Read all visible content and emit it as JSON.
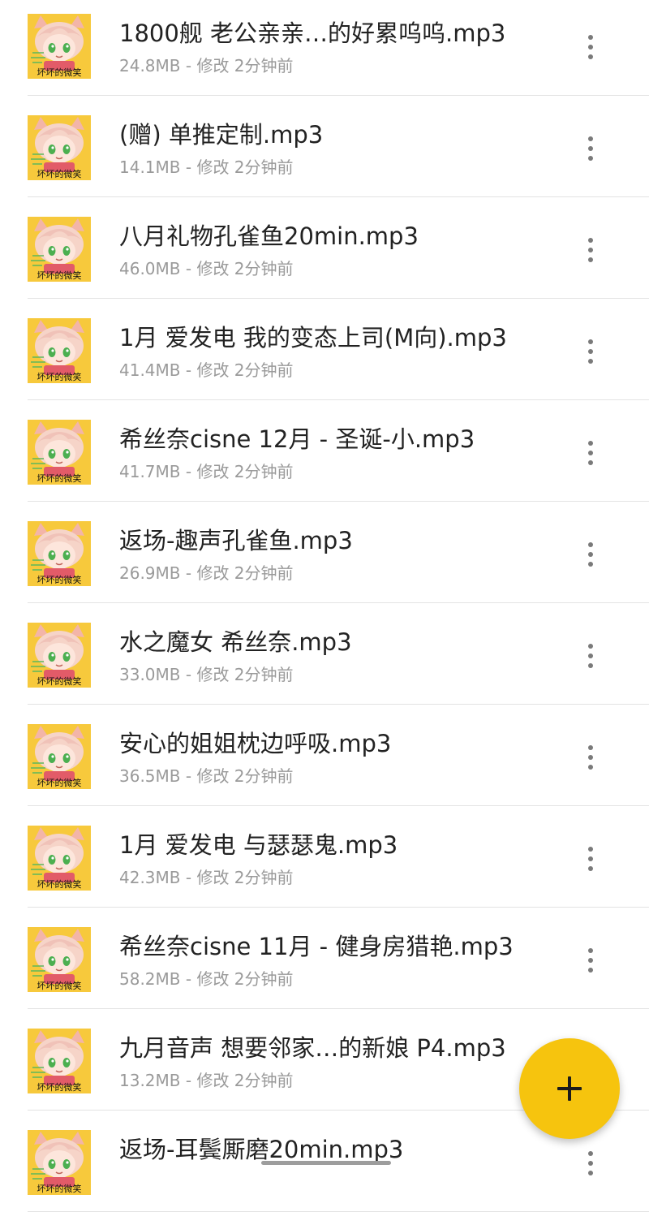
{
  "files": [
    {
      "name": "1800舰 老公亲亲…的好累呜呜.mp3",
      "meta": "24.8MB - 修改 2分钟前"
    },
    {
      "name": "(赠) 单推定制.mp3",
      "meta": "14.1MB - 修改 2分钟前"
    },
    {
      "name": "八月礼物孔雀鱼20min.mp3",
      "meta": "46.0MB - 修改 2分钟前"
    },
    {
      "name": "1月 爱发电 我的变态上司(M向).mp3",
      "meta": "41.4MB - 修改 2分钟前"
    },
    {
      "name": "希丝奈cisne 12月 - 圣诞-小.mp3",
      "meta": "41.7MB - 修改 2分钟前"
    },
    {
      "name": "返场-趣声孔雀鱼.mp3",
      "meta": "26.9MB - 修改 2分钟前"
    },
    {
      "name": "水之魔女 希丝奈.mp3",
      "meta": "33.0MB - 修改 2分钟前"
    },
    {
      "name": "安心的姐姐枕边呼吸.mp3",
      "meta": "36.5MB - 修改 2分钟前"
    },
    {
      "name": "1月 爱发电 与瑟瑟鬼.mp3",
      "meta": "42.3MB - 修改 2分钟前"
    },
    {
      "name": "希丝奈cisne 11月 - 健身房猎艳.mp3",
      "meta": "58.2MB - 修改 2分钟前"
    },
    {
      "name": "九月音声 想要邻家…的新娘 P4.mp3",
      "meta": "13.2MB - 修改 2分钟前"
    },
    {
      "name": "返场-耳鬓厮磨20min.mp3",
      "meta": ""
    }
  ],
  "thumbnail": {
    "caption": "坏坏的微笑",
    "icon": "anime-girl-cover-art"
  },
  "fab": {
    "icon": "plus-icon"
  },
  "colors": {
    "fab": "#f6c40e",
    "thumbnail_bg": "#f7c93c",
    "title": "#222222",
    "meta": "#9a9a9a"
  }
}
